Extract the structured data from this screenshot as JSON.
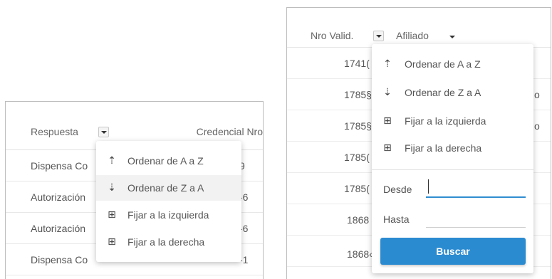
{
  "left_grid": {
    "columns": [
      "Respuesta",
      "Credencial Nro"
    ],
    "rows": [
      {
        "respuesta": "Dispensa Co",
        "right": "9"
      },
      {
        "respuesta": "Autorización",
        "right": "-6"
      },
      {
        "respuesta": "Autorización",
        "right": "-6"
      },
      {
        "respuesta": "Dispensa Co",
        "right": "-1"
      }
    ],
    "menu": [
      {
        "icon": "sort-asc-icon",
        "glyph": "↑⚟",
        "label": "Ordenar de A a Z"
      },
      {
        "icon": "sort-desc-icon",
        "glyph": "↓⚟",
        "label": "Ordenar de Z a A"
      },
      {
        "icon": "pin-left-icon",
        "glyph": "⊞",
        "label": "Fijar a la izquierda"
      },
      {
        "icon": "pin-right-icon",
        "glyph": "⊞",
        "label": "Fijar a la derecha"
      }
    ]
  },
  "right_grid": {
    "columns": [
      "Nro Valid.",
      "Afiliado"
    ],
    "rows": [
      {
        "num": "1741(",
        "edge": ""
      },
      {
        "num": "1785§",
        "edge": "o"
      },
      {
        "num": "1785§",
        "edge": "o"
      },
      {
        "num": "1785(",
        "edge": ""
      },
      {
        "num": "1785(",
        "edge": ""
      },
      {
        "num": "1868",
        "edge": ""
      },
      {
        "num": "1868‹",
        "edge": ""
      }
    ],
    "menu": [
      {
        "icon": "sort-asc-icon",
        "glyph": "↑⚟",
        "label": "Ordenar de A a Z"
      },
      {
        "icon": "sort-desc-icon",
        "glyph": "↓⚟",
        "label": "Ordenar de Z a A"
      },
      {
        "icon": "pin-left-icon",
        "glyph": "⊞",
        "label": "Fijar a la izquierda"
      },
      {
        "icon": "pin-right-icon",
        "glyph": "⊞",
        "label": "Fijar a la derecha"
      }
    ],
    "filter": {
      "desde_label": "Desde",
      "desde_value": "",
      "hasta_label": "Hasta",
      "hasta_value": "",
      "button_label": "Buscar"
    }
  },
  "colors": {
    "accent": "#2b8bd1",
    "focus_underline": "#2f8dcf",
    "border": "#bdbdbd"
  }
}
